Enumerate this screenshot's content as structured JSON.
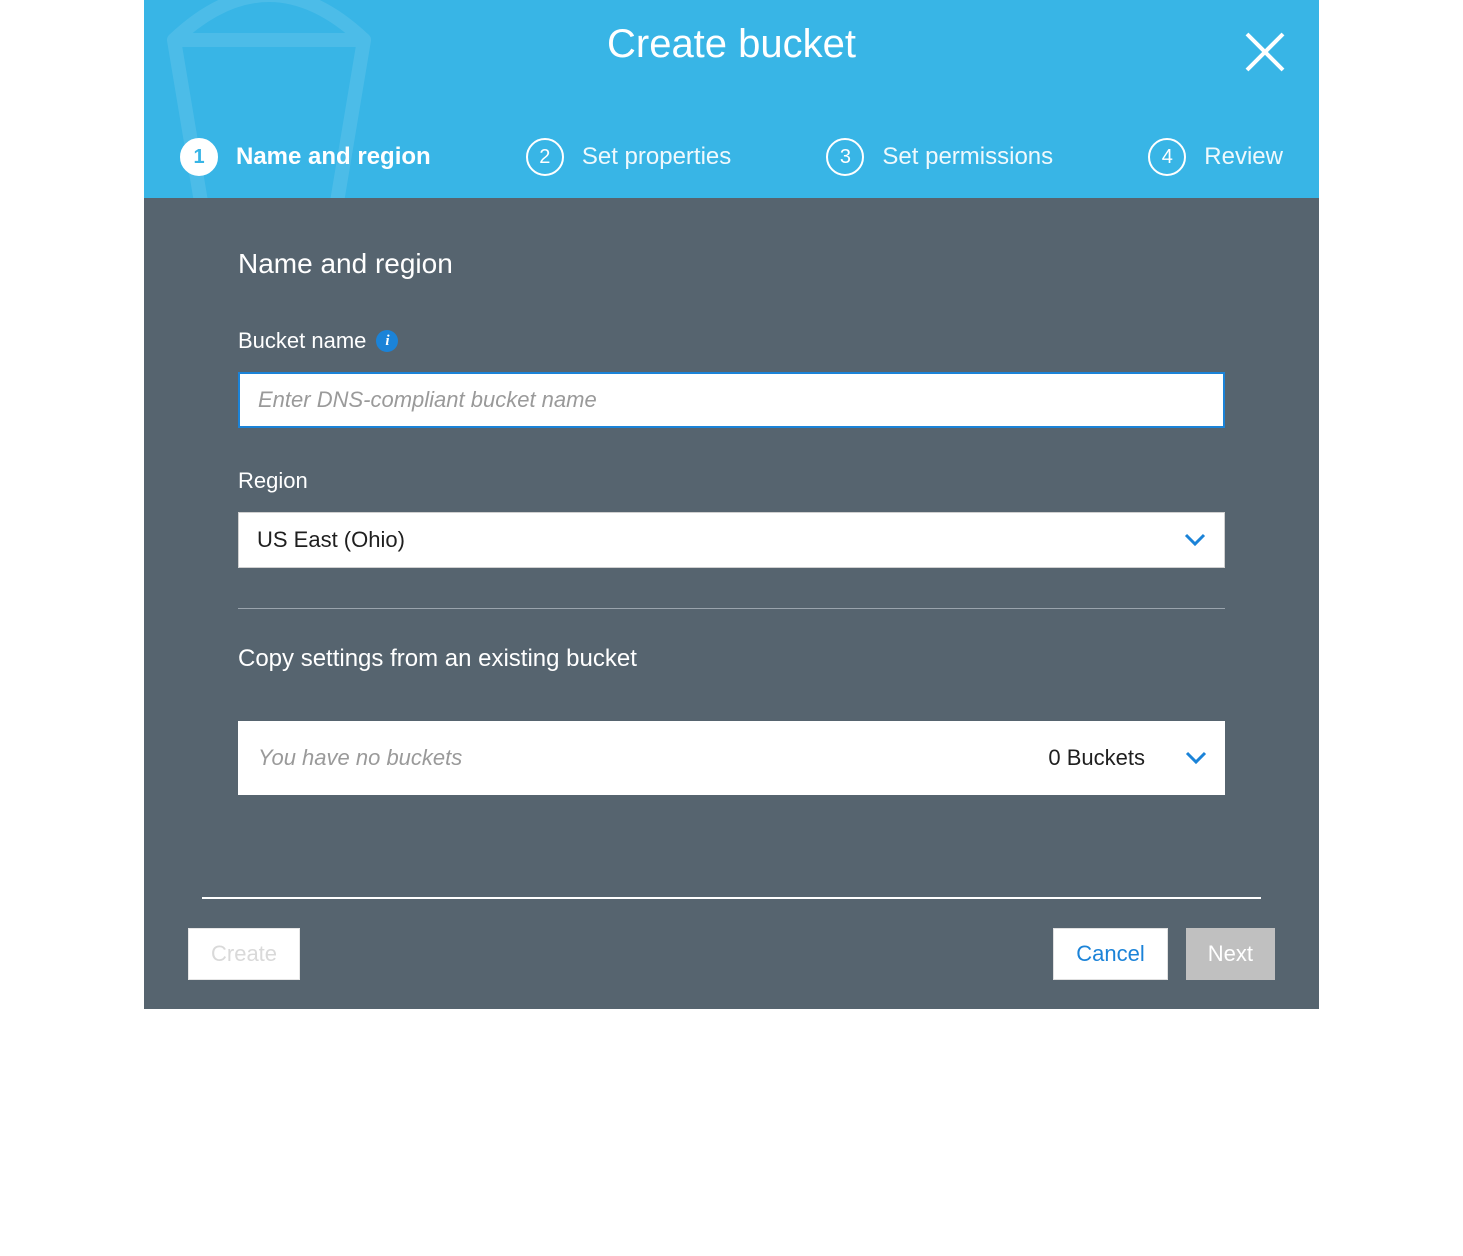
{
  "modal": {
    "title": "Create bucket"
  },
  "steps": [
    {
      "num": "1",
      "label": "Name and region"
    },
    {
      "num": "2",
      "label": "Set properties"
    },
    {
      "num": "3",
      "label": "Set permissions"
    },
    {
      "num": "4",
      "label": "Review"
    }
  ],
  "form": {
    "section_title": "Name and region",
    "bucket_name_label": "Bucket name",
    "bucket_name_placeholder": "Enter DNS-compliant bucket name",
    "bucket_name_value": "",
    "region_label": "Region",
    "region_value": "US East (Ohio)",
    "copy_label": "Copy settings from an existing bucket",
    "copy_placeholder": "You have no buckets",
    "copy_count": "0 Buckets"
  },
  "footer": {
    "create": "Create",
    "cancel": "Cancel",
    "next": "Next"
  },
  "info_glyph": "i"
}
